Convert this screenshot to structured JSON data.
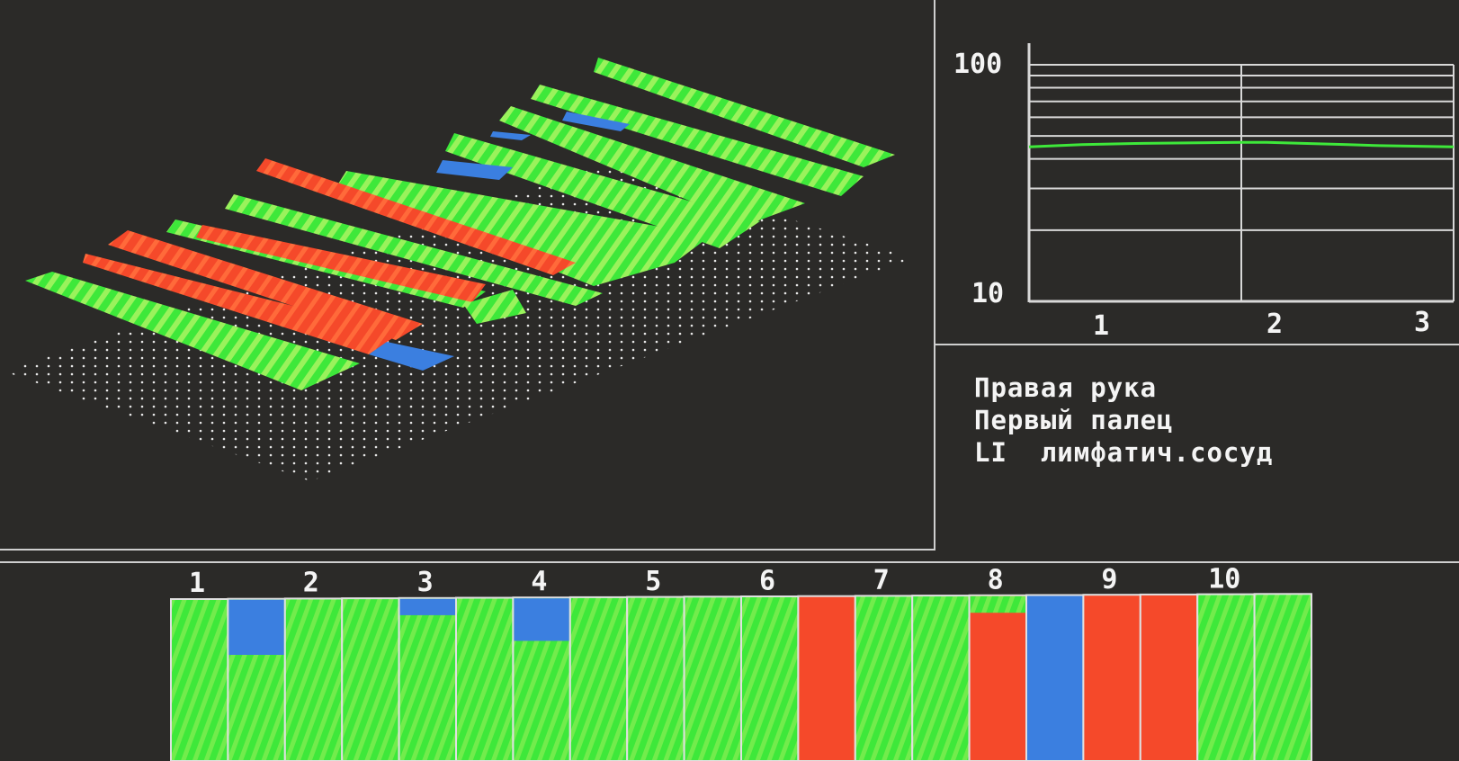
{
  "colors": {
    "green": "#3ee83a",
    "green_light": "#8ef05a",
    "red": "#f5492a",
    "blue": "#3b7fe0",
    "background": "#2b2a28",
    "grid": "#d8d8d8"
  },
  "trend_chart": {
    "type": "line",
    "y_scale": "log",
    "ylim": [
      10,
      100
    ],
    "y_tick_labels": [
      "100",
      "10"
    ],
    "x_tick_labels": [
      "1",
      "2",
      "3"
    ],
    "xlim": [
      1,
      3
    ],
    "grid": true,
    "series": [
      {
        "values": [
          [
            1.0,
            45
          ],
          [
            1.25,
            46
          ],
          [
            1.5,
            46.5
          ],
          [
            2.0,
            47
          ],
          [
            2.12,
            47
          ],
          [
            2.5,
            46
          ],
          [
            2.65,
            45.5
          ],
          [
            3.0,
            45
          ]
        ]
      }
    ]
  },
  "info": {
    "hand": "Правая рука",
    "finger": "Первый палец",
    "channel_code": "LI",
    "channel_name": "лимфатич.сосуд"
  },
  "segment_chart": {
    "type": "bar",
    "group_labels": [
      "1",
      "2",
      "3",
      "4",
      "5",
      "6",
      "7",
      "8",
      "9",
      "10"
    ],
    "bars": [
      {
        "fill": "green"
      },
      {
        "fill": "green",
        "top_blue_fraction": 0.34
      },
      {
        "fill": "green"
      },
      {
        "fill": "green"
      },
      {
        "fill": "green",
        "top_blue_fraction": 0.1
      },
      {
        "fill": "green"
      },
      {
        "fill": "green",
        "top_blue_fraction": 0.26
      },
      {
        "fill": "green"
      },
      {
        "fill": "green"
      },
      {
        "fill": "green"
      },
      {
        "fill": "green"
      },
      {
        "fill": "red"
      },
      {
        "fill": "green"
      },
      {
        "fill": "green"
      },
      {
        "fill": "red",
        "top_green_fraction": 0.1
      },
      {
        "fill": "blue"
      },
      {
        "fill": "red"
      },
      {
        "fill": "red"
      },
      {
        "fill": "green"
      },
      {
        "fill": "green"
      }
    ]
  }
}
